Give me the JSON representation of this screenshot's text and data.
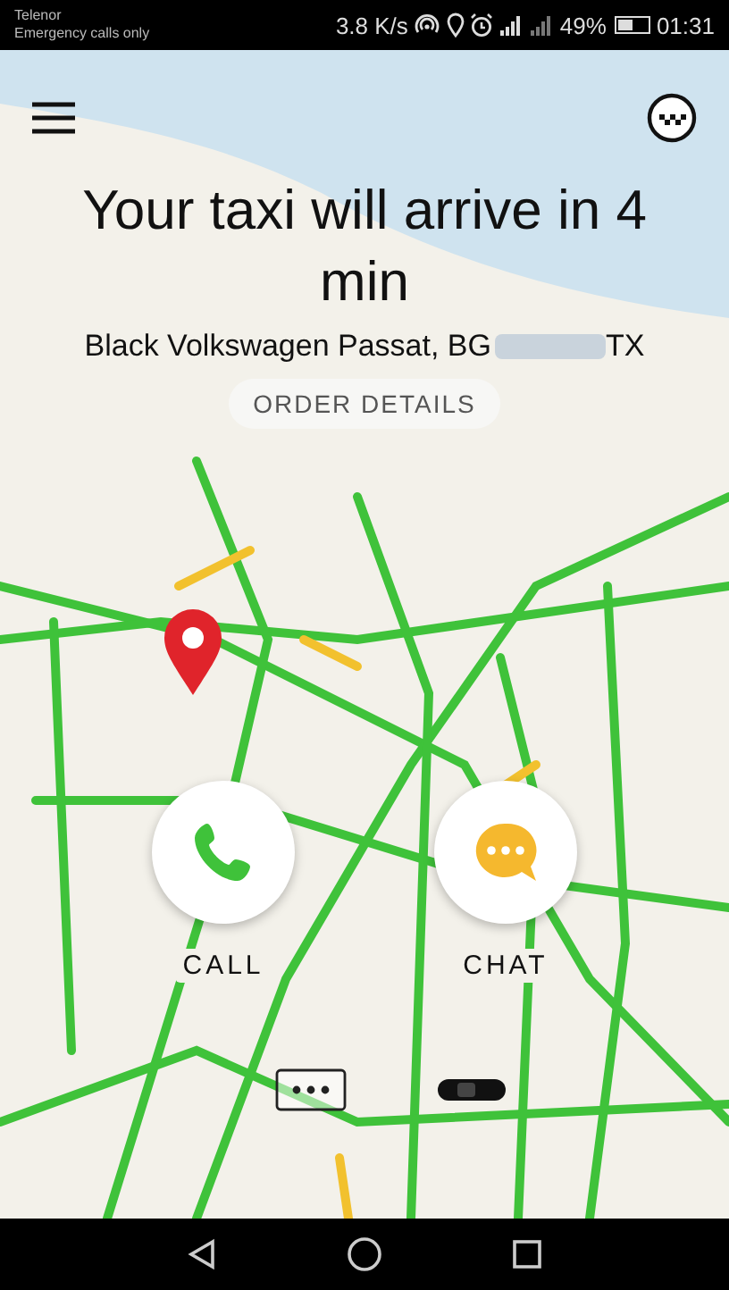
{
  "status_bar": {
    "carrier": "Telenor",
    "carrier_status": "Emergency calls only",
    "speed": "3.8 K/s",
    "battery_percent": "49%",
    "time": "01:31"
  },
  "trip": {
    "title": "Your taxi will arrive in 4 min",
    "car": "Black Volkswagen Passat, BG",
    "plate_end": "TX",
    "details_button": "ORDER DETAILS"
  },
  "actions": [
    {
      "kind": "call",
      "label": "CALL"
    },
    {
      "kind": "chat",
      "label": "CHAT"
    }
  ]
}
